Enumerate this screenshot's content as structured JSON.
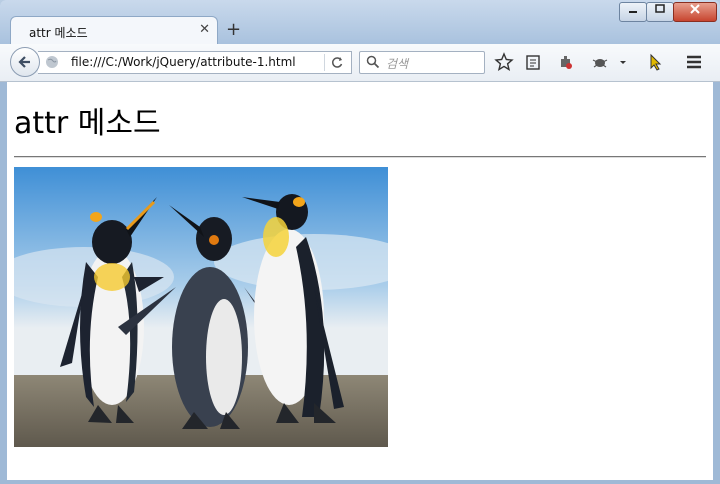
{
  "browser": {
    "tab_title": "attr 메소드",
    "url": "file:///C:/Work/jQuery/attribute-1.html",
    "search_placeholder": "검색",
    "window_controls": [
      "minimize",
      "maximize",
      "close"
    ]
  },
  "page": {
    "heading": "attr 메소드",
    "image_alt": "Penguins"
  },
  "colors": {
    "frame": "#9fb9d6",
    "page_bg": "#ffffff"
  }
}
